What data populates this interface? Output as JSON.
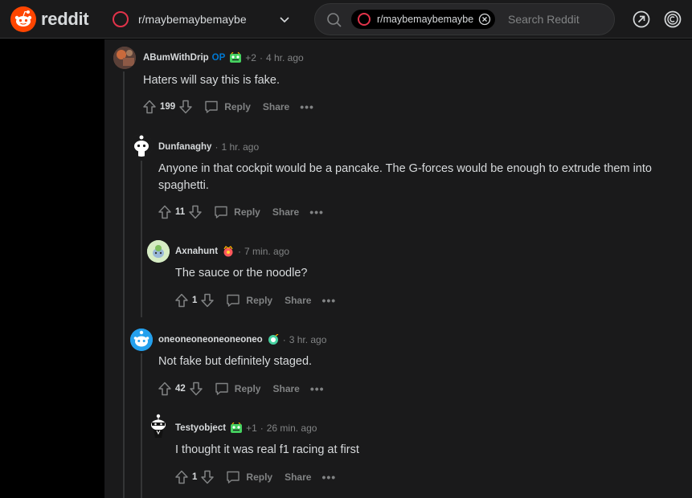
{
  "header": {
    "logo_text": "reddit",
    "subreddit": "r/maybemaybemaybe",
    "search": {
      "chip_label": "r/maybemaybemaybe",
      "placeholder": "Search Reddit"
    }
  },
  "colors": {
    "accent": "#ff4500",
    "op": "#0079d3",
    "meta": "#818384",
    "text": "#d7dadc"
  },
  "comments": [
    {
      "author": "ABumWithDrip",
      "op_label": "OP",
      "flair_extra": "+2",
      "time": "4 hr. ago",
      "body": "Haters will say this is fake.",
      "score": "199",
      "reply": "Reply",
      "share": "Share",
      "more": "•••"
    },
    {
      "author": "Dunfanaghy",
      "time": "1 hr. ago",
      "body": "Anyone in that cockpit would be a pancake. The G-forces would be enough to extrude them into spaghetti.",
      "score": "11",
      "reply": "Reply",
      "share": "Share",
      "more": "•••"
    },
    {
      "author": "Axnahunt",
      "time": "7 min. ago",
      "body": "The sauce or the noodle?",
      "score": "1",
      "reply": "Reply",
      "share": "Share",
      "more": "•••"
    },
    {
      "author": "oneoneoneoneoneoneo",
      "time": "3 hr. ago",
      "body": "Not fake but definitely staged.",
      "score": "42",
      "reply": "Reply",
      "share": "Share",
      "more": "•••"
    },
    {
      "author": "Testyobject",
      "flair_extra": "+1",
      "time": "26 min. ago",
      "body": "I thought it was real f1 racing at first",
      "score": "1",
      "reply": "Reply",
      "share": "Share",
      "more": "•••"
    }
  ],
  "separator": "·"
}
